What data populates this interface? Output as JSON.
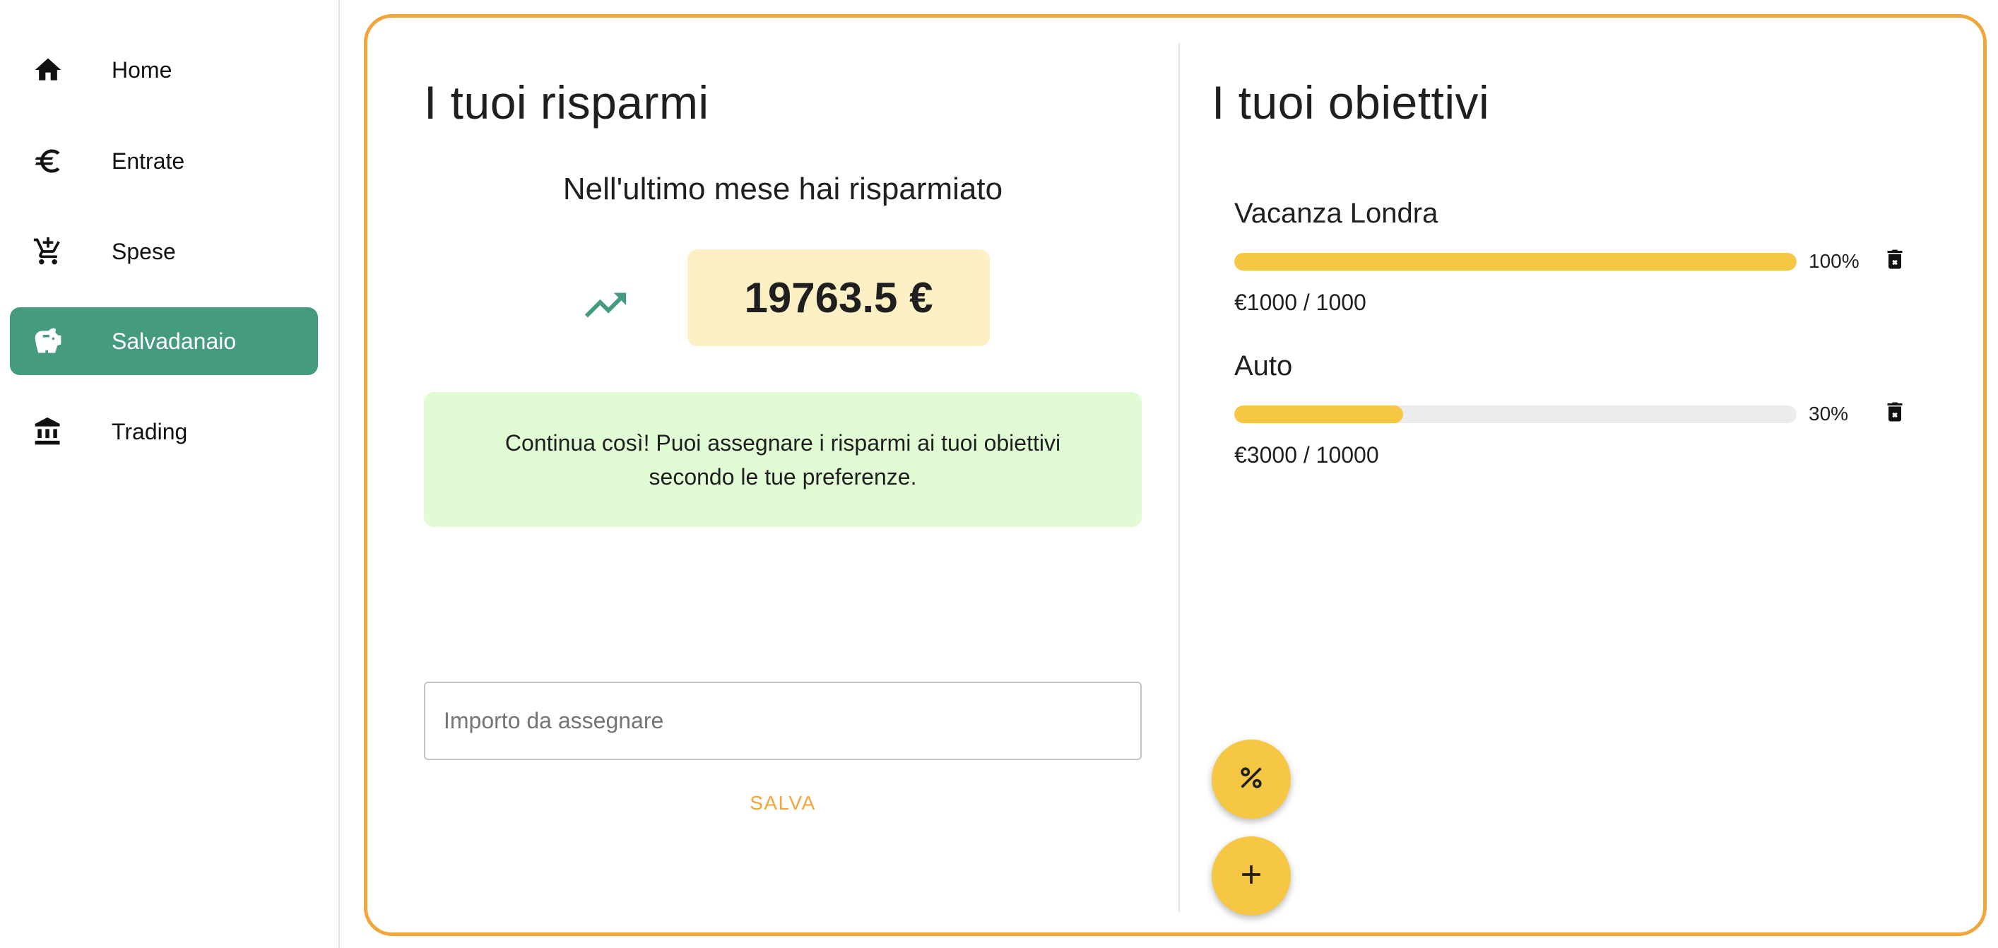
{
  "sidebar": {
    "items": [
      {
        "label": "Home",
        "icon": "home-icon",
        "active": false
      },
      {
        "label": "Entrate",
        "icon": "euro-icon",
        "active": false
      },
      {
        "label": "Spese",
        "icon": "add-cart-icon",
        "active": false
      },
      {
        "label": "Salvadanaio",
        "icon": "piggy-bank-icon",
        "active": true
      },
      {
        "label": "Trading",
        "icon": "bank-icon",
        "active": false
      }
    ]
  },
  "savings": {
    "title": "I tuoi risparmi",
    "subtitle": "Nell'ultimo mese hai risparmiato",
    "trend_icon": "trending-up-icon",
    "amount": "19763.5 €",
    "message": "Continua così! Puoi assegnare i risparmi ai tuoi obiettivi secondo le tue preferenze.",
    "input_placeholder": "Importo da assegnare",
    "input_value": "",
    "save_label": "SALVA"
  },
  "goals": {
    "title": "I tuoi obiettivi",
    "items": [
      {
        "name": "Vacanza Londra",
        "progress": 100,
        "percent_label": "100%",
        "amount_label": "€1000 / 1000"
      },
      {
        "name": "Auto",
        "progress": 30,
        "percent_label": "30%",
        "amount_label": "€3000 / 10000"
      }
    ]
  },
  "fabs": {
    "percent_icon": "percent-icon",
    "add_icon": "plus-icon"
  },
  "colors": {
    "accent_green": "#459b7e",
    "card_border": "#f0a63a",
    "progress_fill": "#f6c744",
    "amount_bg": "#fcf0c4",
    "info_bg": "#e1fcd4"
  }
}
